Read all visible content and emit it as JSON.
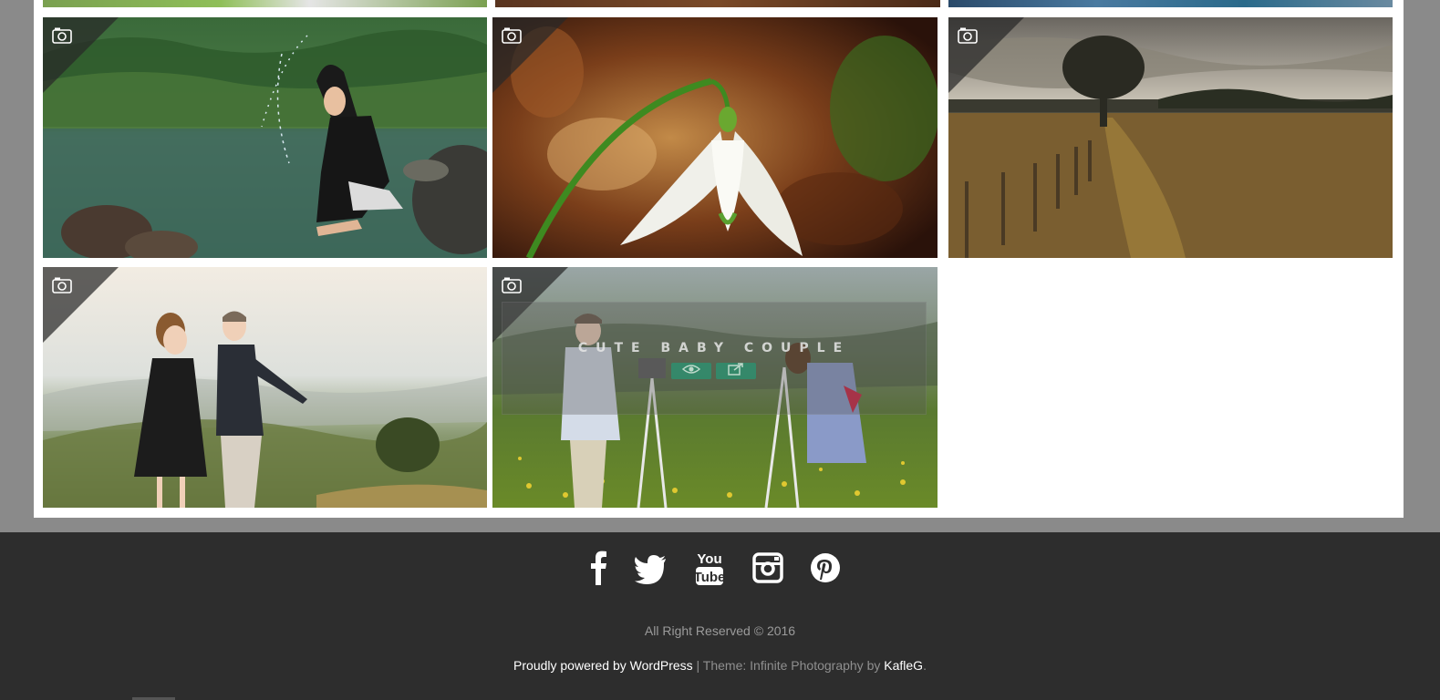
{
  "gallery": {
    "tiles": [
      {
        "name": "water-splash-girl-photo"
      },
      {
        "name": "snowdrop-flower-photo"
      },
      {
        "name": "field-tree-landscape-photo"
      },
      {
        "name": "kids-kissing-photo"
      },
      {
        "name": "cute-baby-couple-photo",
        "hover_title": "CUTE BABY COUPLE"
      }
    ],
    "post_format_icon": "camera-icon",
    "hover_buttons": [
      "eye-icon",
      "external-link-icon"
    ]
  },
  "footer": {
    "social": [
      "facebook-icon",
      "twitter-icon",
      "youtube-icon",
      "instagram-icon",
      "pinterest-icon"
    ],
    "copyright": "All Right Reserved © 2016",
    "powered_link": "Proudly powered by WordPress",
    "separator": " | Theme: Infinite Photography by ",
    "author_link": "KafleG",
    "period": "."
  },
  "colors": {
    "page_bg": "#8a8a8a",
    "panel_bg": "#ffffff",
    "footer_bg": "#2d2d2d",
    "accent": "#2f8f6f"
  }
}
